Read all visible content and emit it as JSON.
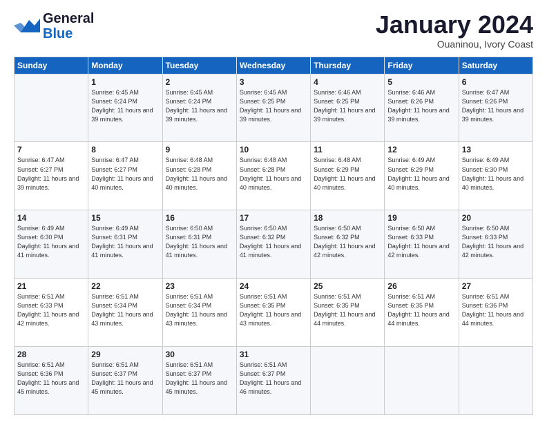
{
  "header": {
    "logo_line1": "General",
    "logo_line2": "Blue",
    "month": "January 2024",
    "location": "Ouaninou, Ivory Coast"
  },
  "days_of_week": [
    "Sunday",
    "Monday",
    "Tuesday",
    "Wednesday",
    "Thursday",
    "Friday",
    "Saturday"
  ],
  "weeks": [
    [
      {
        "day": "",
        "sunrise": "",
        "sunset": "",
        "daylight": ""
      },
      {
        "day": "1",
        "sunrise": "Sunrise: 6:45 AM",
        "sunset": "Sunset: 6:24 PM",
        "daylight": "Daylight: 11 hours and 39 minutes."
      },
      {
        "day": "2",
        "sunrise": "Sunrise: 6:45 AM",
        "sunset": "Sunset: 6:24 PM",
        "daylight": "Daylight: 11 hours and 39 minutes."
      },
      {
        "day": "3",
        "sunrise": "Sunrise: 6:45 AM",
        "sunset": "Sunset: 6:25 PM",
        "daylight": "Daylight: 11 hours and 39 minutes."
      },
      {
        "day": "4",
        "sunrise": "Sunrise: 6:46 AM",
        "sunset": "Sunset: 6:25 PM",
        "daylight": "Daylight: 11 hours and 39 minutes."
      },
      {
        "day": "5",
        "sunrise": "Sunrise: 6:46 AM",
        "sunset": "Sunset: 6:26 PM",
        "daylight": "Daylight: 11 hours and 39 minutes."
      },
      {
        "day": "6",
        "sunrise": "Sunrise: 6:47 AM",
        "sunset": "Sunset: 6:26 PM",
        "daylight": "Daylight: 11 hours and 39 minutes."
      }
    ],
    [
      {
        "day": "7",
        "sunrise": "Sunrise: 6:47 AM",
        "sunset": "Sunset: 6:27 PM",
        "daylight": "Daylight: 11 hours and 39 minutes."
      },
      {
        "day": "8",
        "sunrise": "Sunrise: 6:47 AM",
        "sunset": "Sunset: 6:27 PM",
        "daylight": "Daylight: 11 hours and 40 minutes."
      },
      {
        "day": "9",
        "sunrise": "Sunrise: 6:48 AM",
        "sunset": "Sunset: 6:28 PM",
        "daylight": "Daylight: 11 hours and 40 minutes."
      },
      {
        "day": "10",
        "sunrise": "Sunrise: 6:48 AM",
        "sunset": "Sunset: 6:28 PM",
        "daylight": "Daylight: 11 hours and 40 minutes."
      },
      {
        "day": "11",
        "sunrise": "Sunrise: 6:48 AM",
        "sunset": "Sunset: 6:29 PM",
        "daylight": "Daylight: 11 hours and 40 minutes."
      },
      {
        "day": "12",
        "sunrise": "Sunrise: 6:49 AM",
        "sunset": "Sunset: 6:29 PM",
        "daylight": "Daylight: 11 hours and 40 minutes."
      },
      {
        "day": "13",
        "sunrise": "Sunrise: 6:49 AM",
        "sunset": "Sunset: 6:30 PM",
        "daylight": "Daylight: 11 hours and 40 minutes."
      }
    ],
    [
      {
        "day": "14",
        "sunrise": "Sunrise: 6:49 AM",
        "sunset": "Sunset: 6:30 PM",
        "daylight": "Daylight: 11 hours and 41 minutes."
      },
      {
        "day": "15",
        "sunrise": "Sunrise: 6:49 AM",
        "sunset": "Sunset: 6:31 PM",
        "daylight": "Daylight: 11 hours and 41 minutes."
      },
      {
        "day": "16",
        "sunrise": "Sunrise: 6:50 AM",
        "sunset": "Sunset: 6:31 PM",
        "daylight": "Daylight: 11 hours and 41 minutes."
      },
      {
        "day": "17",
        "sunrise": "Sunrise: 6:50 AM",
        "sunset": "Sunset: 6:32 PM",
        "daylight": "Daylight: 11 hours and 41 minutes."
      },
      {
        "day": "18",
        "sunrise": "Sunrise: 6:50 AM",
        "sunset": "Sunset: 6:32 PM",
        "daylight": "Daylight: 11 hours and 42 minutes."
      },
      {
        "day": "19",
        "sunrise": "Sunrise: 6:50 AM",
        "sunset": "Sunset: 6:33 PM",
        "daylight": "Daylight: 11 hours and 42 minutes."
      },
      {
        "day": "20",
        "sunrise": "Sunrise: 6:50 AM",
        "sunset": "Sunset: 6:33 PM",
        "daylight": "Daylight: 11 hours and 42 minutes."
      }
    ],
    [
      {
        "day": "21",
        "sunrise": "Sunrise: 6:51 AM",
        "sunset": "Sunset: 6:33 PM",
        "daylight": "Daylight: 11 hours and 42 minutes."
      },
      {
        "day": "22",
        "sunrise": "Sunrise: 6:51 AM",
        "sunset": "Sunset: 6:34 PM",
        "daylight": "Daylight: 11 hours and 43 minutes."
      },
      {
        "day": "23",
        "sunrise": "Sunrise: 6:51 AM",
        "sunset": "Sunset: 6:34 PM",
        "daylight": "Daylight: 11 hours and 43 minutes."
      },
      {
        "day": "24",
        "sunrise": "Sunrise: 6:51 AM",
        "sunset": "Sunset: 6:35 PM",
        "daylight": "Daylight: 11 hours and 43 minutes."
      },
      {
        "day": "25",
        "sunrise": "Sunrise: 6:51 AM",
        "sunset": "Sunset: 6:35 PM",
        "daylight": "Daylight: 11 hours and 44 minutes."
      },
      {
        "day": "26",
        "sunrise": "Sunrise: 6:51 AM",
        "sunset": "Sunset: 6:35 PM",
        "daylight": "Daylight: 11 hours and 44 minutes."
      },
      {
        "day": "27",
        "sunrise": "Sunrise: 6:51 AM",
        "sunset": "Sunset: 6:36 PM",
        "daylight": "Daylight: 11 hours and 44 minutes."
      }
    ],
    [
      {
        "day": "28",
        "sunrise": "Sunrise: 6:51 AM",
        "sunset": "Sunset: 6:36 PM",
        "daylight": "Daylight: 11 hours and 45 minutes."
      },
      {
        "day": "29",
        "sunrise": "Sunrise: 6:51 AM",
        "sunset": "Sunset: 6:37 PM",
        "daylight": "Daylight: 11 hours and 45 minutes."
      },
      {
        "day": "30",
        "sunrise": "Sunrise: 6:51 AM",
        "sunset": "Sunset: 6:37 PM",
        "daylight": "Daylight: 11 hours and 45 minutes."
      },
      {
        "day": "31",
        "sunrise": "Sunrise: 6:51 AM",
        "sunset": "Sunset: 6:37 PM",
        "daylight": "Daylight: 11 hours and 46 minutes."
      },
      {
        "day": "",
        "sunrise": "",
        "sunset": "",
        "daylight": ""
      },
      {
        "day": "",
        "sunrise": "",
        "sunset": "",
        "daylight": ""
      },
      {
        "day": "",
        "sunrise": "",
        "sunset": "",
        "daylight": ""
      }
    ]
  ]
}
